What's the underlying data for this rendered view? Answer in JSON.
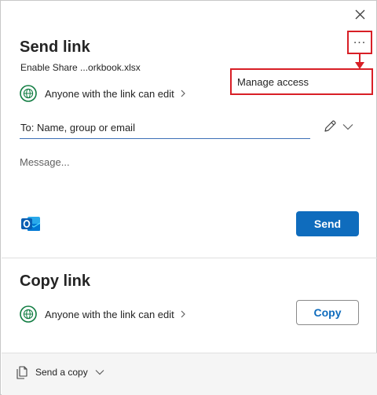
{
  "dialog": {
    "close_label": "×"
  },
  "send_link": {
    "title": "Send link",
    "filename": "Enable Share ...orkbook.xlsx",
    "more_options": "...",
    "menu": {
      "manage_access": "Manage access"
    },
    "permission": "Anyone with the link can edit",
    "to_placeholder": "To: Name, group or email",
    "message_placeholder": "Message...",
    "send_label": "Send"
  },
  "copy_link": {
    "title": "Copy link",
    "permission": "Anyone with the link can edit",
    "copy_label": "Copy"
  },
  "footer": {
    "send_copy_label": "Send a copy"
  },
  "colors": {
    "accent": "#0f6cbd",
    "annotation_red": "#d81f26",
    "globe_green": "#107c41",
    "outlook_blue": "#0a5fb3"
  }
}
